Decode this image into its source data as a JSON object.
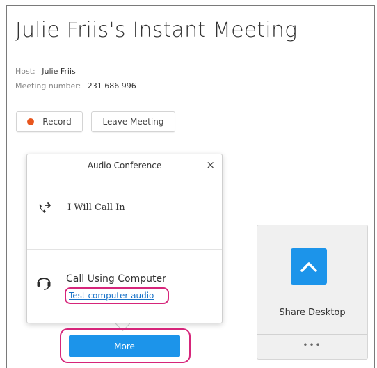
{
  "meeting": {
    "title": "Julie Friis's Instant Meeting",
    "host_label": "Host:",
    "host_value": "Julie Friis",
    "number_label": "Meeting number:",
    "number_value": "231 686 996"
  },
  "controls": {
    "record_label": "Record",
    "leave_label": "Leave Meeting"
  },
  "audio_popup": {
    "title": "Audio Conference",
    "close_glyph": "×",
    "options": [
      {
        "label": "I Will Call In",
        "icon": "phone-call-in-icon"
      },
      {
        "label": "Call Using Computer",
        "icon": "headset-icon",
        "link": "Test computer audio"
      }
    ]
  },
  "more_button_label": "More",
  "share_card": {
    "label": "Share Desktop",
    "icon": "chevron-up-icon",
    "more_glyph": "•••"
  },
  "colors": {
    "accent": "#1c94ea",
    "record": "#e8561e",
    "highlight": "#d6257a",
    "link": "#1a73c8"
  }
}
